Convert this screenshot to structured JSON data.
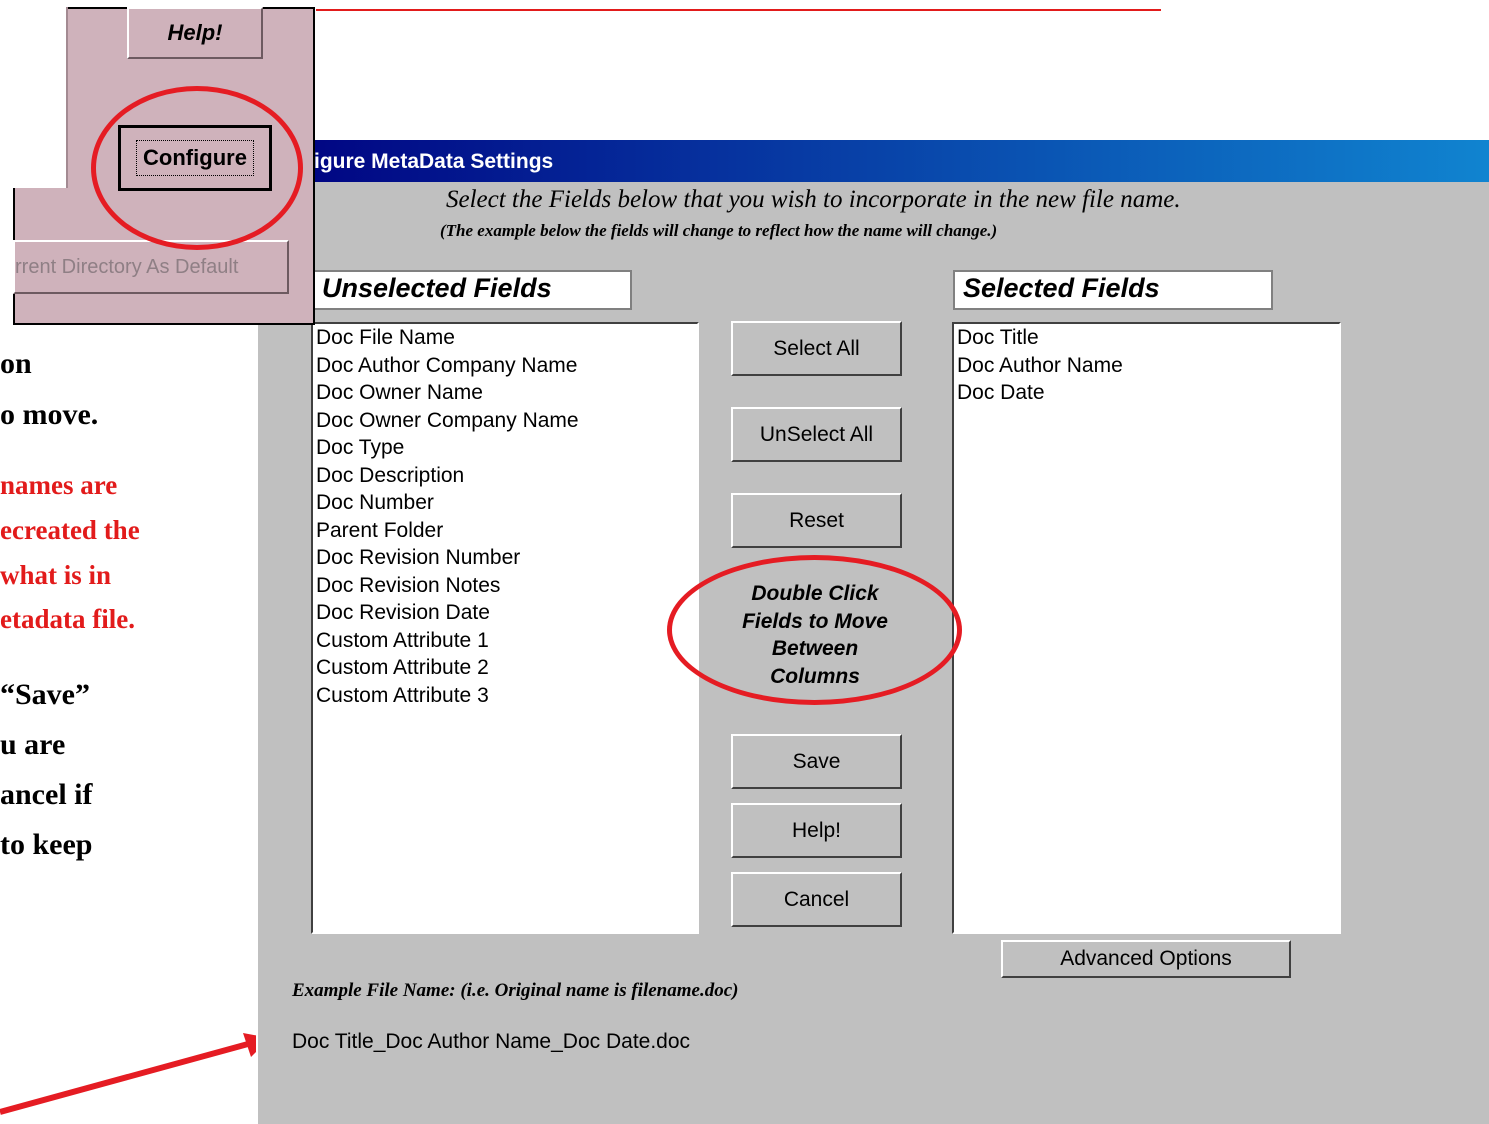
{
  "slide": {
    "lines": [
      "on",
      "o move.",
      "names are",
      "ecreated the",
      " what is in",
      "etadata file.",
      "“Save”",
      "u are",
      "ancel if",
      " to keep"
    ]
  },
  "inset": {
    "help_label": "Help!",
    "configure_label": "Configure",
    "default_dir_label": "rrent Directory As Default"
  },
  "dialog": {
    "title": "igure MetaData Settings",
    "instruction": "Select the Fields below that you wish to incorporate in the new file name.",
    "sub_instruction": "(The example below the fields will change to reflect how the name will change.)",
    "unselected_header": "Unselected Fields",
    "selected_header": "Selected Fields",
    "unselected_items": [
      "Doc File Name",
      "Doc Author Company Name",
      "Doc Owner Name",
      "Doc Owner Company Name",
      "Doc Type",
      "Doc Description",
      "Doc Number",
      "Parent Folder",
      "Doc Revision Number",
      "Doc Revision Notes",
      "Doc Revision Date",
      "Custom Attribute 1",
      "Custom Attribute 2",
      "Custom Attribute 3"
    ],
    "selected_items": [
      "Doc Title",
      "Doc Author Name",
      "Doc Date"
    ],
    "buttons": {
      "select_all": "Select All",
      "unselect_all": "UnSelect All",
      "reset": "Reset",
      "save": "Save",
      "help": "Help!",
      "cancel": "Cancel",
      "advanced": "Advanced Options"
    },
    "hint_lines": [
      "Double Click",
      "Fields to Move",
      "Between",
      "Columns"
    ],
    "example_label": "Example File Name: (i.e. Original name is filename.doc)",
    "example_value": "Doc Title_Doc Author Name_Doc Date.doc"
  },
  "colors": {
    "annotation_red": "#e51c23",
    "title_gradient_start": "#000080",
    "title_gradient_end": "#1084d0",
    "dialog_gray": "#c0c0c0",
    "inset_mauve": "#cfb2bb"
  }
}
